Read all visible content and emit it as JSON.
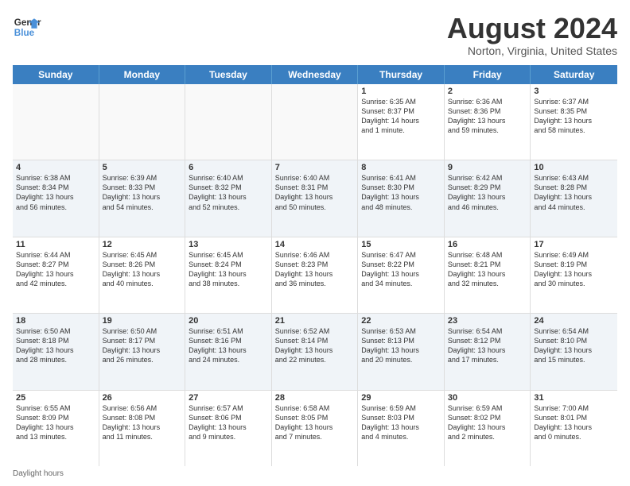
{
  "header": {
    "logo_line1": "General",
    "logo_line2": "Blue",
    "title": "August 2024",
    "subtitle": "Norton, Virginia, United States"
  },
  "days_of_week": [
    "Sunday",
    "Monday",
    "Tuesday",
    "Wednesday",
    "Thursday",
    "Friday",
    "Saturday"
  ],
  "footer": "Daylight hours",
  "weeks": [
    [
      {
        "day": "",
        "empty": true
      },
      {
        "day": "",
        "empty": true
      },
      {
        "day": "",
        "empty": true
      },
      {
        "day": "",
        "empty": true
      },
      {
        "day": "1",
        "line1": "Sunrise: 6:35 AM",
        "line2": "Sunset: 8:37 PM",
        "line3": "Daylight: 14 hours",
        "line4": "and 1 minute."
      },
      {
        "day": "2",
        "line1": "Sunrise: 6:36 AM",
        "line2": "Sunset: 8:36 PM",
        "line3": "Daylight: 13 hours",
        "line4": "and 59 minutes."
      },
      {
        "day": "3",
        "line1": "Sunrise: 6:37 AM",
        "line2": "Sunset: 8:35 PM",
        "line3": "Daylight: 13 hours",
        "line4": "and 58 minutes."
      }
    ],
    [
      {
        "day": "4",
        "line1": "Sunrise: 6:38 AM",
        "line2": "Sunset: 8:34 PM",
        "line3": "Daylight: 13 hours",
        "line4": "and 56 minutes."
      },
      {
        "day": "5",
        "line1": "Sunrise: 6:39 AM",
        "line2": "Sunset: 8:33 PM",
        "line3": "Daylight: 13 hours",
        "line4": "and 54 minutes."
      },
      {
        "day": "6",
        "line1": "Sunrise: 6:40 AM",
        "line2": "Sunset: 8:32 PM",
        "line3": "Daylight: 13 hours",
        "line4": "and 52 minutes."
      },
      {
        "day": "7",
        "line1": "Sunrise: 6:40 AM",
        "line2": "Sunset: 8:31 PM",
        "line3": "Daylight: 13 hours",
        "line4": "and 50 minutes."
      },
      {
        "day": "8",
        "line1": "Sunrise: 6:41 AM",
        "line2": "Sunset: 8:30 PM",
        "line3": "Daylight: 13 hours",
        "line4": "and 48 minutes."
      },
      {
        "day": "9",
        "line1": "Sunrise: 6:42 AM",
        "line2": "Sunset: 8:29 PM",
        "line3": "Daylight: 13 hours",
        "line4": "and 46 minutes."
      },
      {
        "day": "10",
        "line1": "Sunrise: 6:43 AM",
        "line2": "Sunset: 8:28 PM",
        "line3": "Daylight: 13 hours",
        "line4": "and 44 minutes."
      }
    ],
    [
      {
        "day": "11",
        "line1": "Sunrise: 6:44 AM",
        "line2": "Sunset: 8:27 PM",
        "line3": "Daylight: 13 hours",
        "line4": "and 42 minutes."
      },
      {
        "day": "12",
        "line1": "Sunrise: 6:45 AM",
        "line2": "Sunset: 8:26 PM",
        "line3": "Daylight: 13 hours",
        "line4": "and 40 minutes."
      },
      {
        "day": "13",
        "line1": "Sunrise: 6:45 AM",
        "line2": "Sunset: 8:24 PM",
        "line3": "Daylight: 13 hours",
        "line4": "and 38 minutes."
      },
      {
        "day": "14",
        "line1": "Sunrise: 6:46 AM",
        "line2": "Sunset: 8:23 PM",
        "line3": "Daylight: 13 hours",
        "line4": "and 36 minutes."
      },
      {
        "day": "15",
        "line1": "Sunrise: 6:47 AM",
        "line2": "Sunset: 8:22 PM",
        "line3": "Daylight: 13 hours",
        "line4": "and 34 minutes."
      },
      {
        "day": "16",
        "line1": "Sunrise: 6:48 AM",
        "line2": "Sunset: 8:21 PM",
        "line3": "Daylight: 13 hours",
        "line4": "and 32 minutes."
      },
      {
        "day": "17",
        "line1": "Sunrise: 6:49 AM",
        "line2": "Sunset: 8:19 PM",
        "line3": "Daylight: 13 hours",
        "line4": "and 30 minutes."
      }
    ],
    [
      {
        "day": "18",
        "line1": "Sunrise: 6:50 AM",
        "line2": "Sunset: 8:18 PM",
        "line3": "Daylight: 13 hours",
        "line4": "and 28 minutes."
      },
      {
        "day": "19",
        "line1": "Sunrise: 6:50 AM",
        "line2": "Sunset: 8:17 PM",
        "line3": "Daylight: 13 hours",
        "line4": "and 26 minutes."
      },
      {
        "day": "20",
        "line1": "Sunrise: 6:51 AM",
        "line2": "Sunset: 8:16 PM",
        "line3": "Daylight: 13 hours",
        "line4": "and 24 minutes."
      },
      {
        "day": "21",
        "line1": "Sunrise: 6:52 AM",
        "line2": "Sunset: 8:14 PM",
        "line3": "Daylight: 13 hours",
        "line4": "and 22 minutes."
      },
      {
        "day": "22",
        "line1": "Sunrise: 6:53 AM",
        "line2": "Sunset: 8:13 PM",
        "line3": "Daylight: 13 hours",
        "line4": "and 20 minutes."
      },
      {
        "day": "23",
        "line1": "Sunrise: 6:54 AM",
        "line2": "Sunset: 8:12 PM",
        "line3": "Daylight: 13 hours",
        "line4": "and 17 minutes."
      },
      {
        "day": "24",
        "line1": "Sunrise: 6:54 AM",
        "line2": "Sunset: 8:10 PM",
        "line3": "Daylight: 13 hours",
        "line4": "and 15 minutes."
      }
    ],
    [
      {
        "day": "25",
        "line1": "Sunrise: 6:55 AM",
        "line2": "Sunset: 8:09 PM",
        "line3": "Daylight: 13 hours",
        "line4": "and 13 minutes."
      },
      {
        "day": "26",
        "line1": "Sunrise: 6:56 AM",
        "line2": "Sunset: 8:08 PM",
        "line3": "Daylight: 13 hours",
        "line4": "and 11 minutes."
      },
      {
        "day": "27",
        "line1": "Sunrise: 6:57 AM",
        "line2": "Sunset: 8:06 PM",
        "line3": "Daylight: 13 hours",
        "line4": "and 9 minutes."
      },
      {
        "day": "28",
        "line1": "Sunrise: 6:58 AM",
        "line2": "Sunset: 8:05 PM",
        "line3": "Daylight: 13 hours",
        "line4": "and 7 minutes."
      },
      {
        "day": "29",
        "line1": "Sunrise: 6:59 AM",
        "line2": "Sunset: 8:03 PM",
        "line3": "Daylight: 13 hours",
        "line4": "and 4 minutes."
      },
      {
        "day": "30",
        "line1": "Sunrise: 6:59 AM",
        "line2": "Sunset: 8:02 PM",
        "line3": "Daylight: 13 hours",
        "line4": "and 2 minutes."
      },
      {
        "day": "31",
        "line1": "Sunrise: 7:00 AM",
        "line2": "Sunset: 8:01 PM",
        "line3": "Daylight: 13 hours",
        "line4": "and 0 minutes."
      }
    ]
  ]
}
